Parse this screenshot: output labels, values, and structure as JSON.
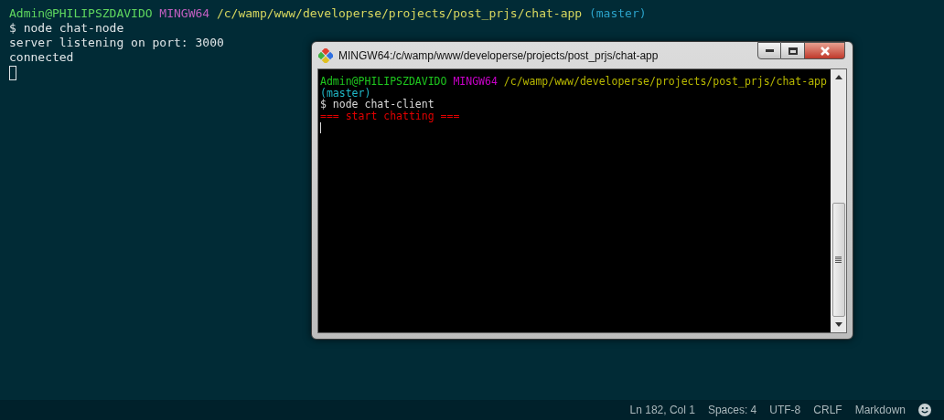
{
  "terminal": {
    "prompt": [
      {
        "kind": "user",
        "text": "Admin@PHILIPSZDAVIDO"
      },
      {
        "kind": "system",
        "text": "MINGW64"
      },
      {
        "kind": "path",
        "text": "/c/wamp/www/developerse/projects/post_prjs/chat-app"
      },
      {
        "kind": "branch",
        "text": "(master)"
      }
    ],
    "lines": [
      "$ node chat-node",
      "server listening on port: 3000",
      "connected"
    ]
  },
  "window": {
    "title": "MINGW64:/c/wamp/www/developerse/projects/post_prjs/chat-app",
    "prompt": [
      {
        "kind": "user",
        "text": "Admin@PHILIPSZDAVIDO"
      },
      {
        "kind": "system",
        "text": "MINGW64"
      },
      {
        "kind": "path",
        "text": "/c/wamp/www/developerse/projects/post_prjs/chat-app"
      },
      {
        "kind": "branch",
        "text": "(master)"
      }
    ],
    "lines": [
      {
        "kind": "command",
        "text": "$ node chat-client"
      },
      {
        "kind": "error",
        "text": "=== start chatting ==="
      }
    ]
  },
  "status_bar": {
    "items": [
      "Ln 182, Col 1",
      "Spaces: 4",
      "UTF-8",
      "CRLF",
      "Markdown"
    ]
  }
}
